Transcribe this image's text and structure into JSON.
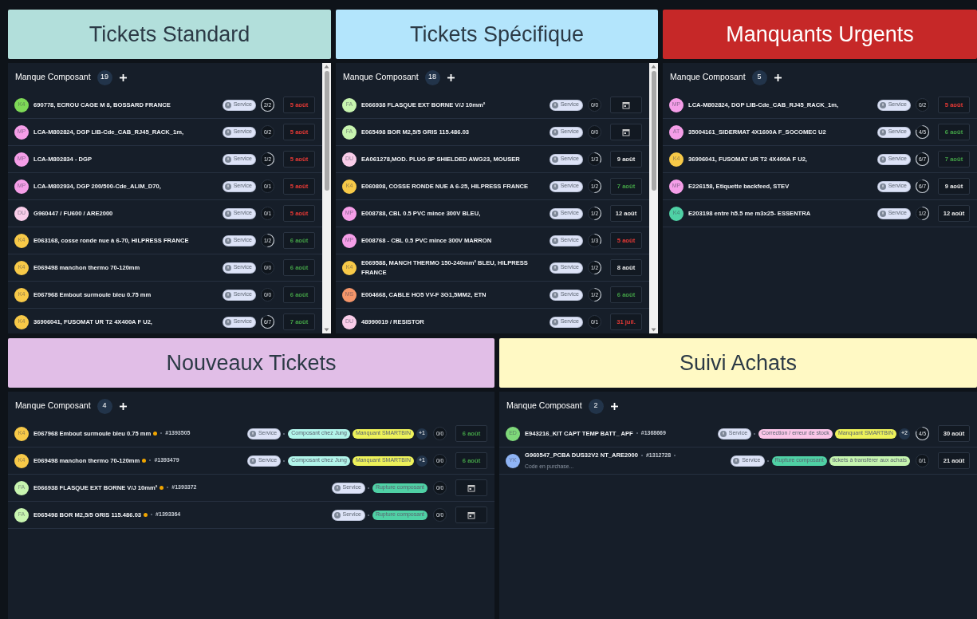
{
  "board_rows": [
    {
      "boards": [
        {
          "title": "Tickets Standard",
          "color": "#b2dfdb",
          "list_title": "Manque Composant",
          "count": "19",
          "scrollable": true,
          "items": [
            {
              "initials": "K4",
              "color": "#7ed957",
              "title": "690778, ECROU CAGE M 8, BOSSARD FRANCE",
              "tags": [
                {
                  "kind": "service",
                  "label": "Service",
                  "color": "#dde3f7"
                }
              ],
              "progress": "2/2",
              "due": {
                "kind": "date",
                "text": "5 août",
                "color": "#e53935"
              }
            },
            {
              "initials": "MP",
              "color": "#f59ee8",
              "title": "LCA-M802824, DGP LIB-Cde_CAB_RJ45_RACK_1m,",
              "tags": [
                {
                  "kind": "service",
                  "label": "Service",
                  "color": "#dde3f7"
                }
              ],
              "progress": "0/2",
              "due": {
                "kind": "date",
                "text": "5 août",
                "color": "#e53935"
              }
            },
            {
              "initials": "MP",
              "color": "#f59ee8",
              "title": "LCA-M802834 - DGP",
              "tags": [
                {
                  "kind": "service",
                  "label": "Service",
                  "color": "#dde3f7"
                }
              ],
              "progress": "1/2",
              "due": {
                "kind": "date",
                "text": "5 août",
                "color": "#e53935"
              }
            },
            {
              "initials": "MP",
              "color": "#f59ee8",
              "title": "LCA-M802934, DGP 200/500-Cde_ALIM_D70,",
              "tags": [
                {
                  "kind": "service",
                  "label": "Service",
                  "color": "#dde3f7"
                }
              ],
              "progress": "0/1",
              "due": {
                "kind": "date",
                "text": "5 août",
                "color": "#e53935"
              }
            },
            {
              "initials": "DU",
              "color": "#f9cde9",
              "title": "G960447 / FU600 / ARE2000",
              "tags": [
                {
                  "kind": "service",
                  "label": "Service",
                  "color": "#dde3f7"
                }
              ],
              "progress": "0/1",
              "due": {
                "kind": "date",
                "text": "5 août",
                "color": "#e53935"
              }
            },
            {
              "initials": "K4",
              "color": "#f7c948",
              "title": "E063168, cosse ronde nue à 6-70, HILPRESS FRANCE",
              "tags": [
                {
                  "kind": "service",
                  "label": "Service",
                  "color": "#dde3f7"
                }
              ],
              "progress": "1/2",
              "due": {
                "kind": "date",
                "text": "6 août",
                "color": "#43a047"
              }
            },
            {
              "initials": "K4",
              "color": "#f7c948",
              "title": "E069498 manchon thermo 70-120mm",
              "tags": [
                {
                  "kind": "service",
                  "label": "Service",
                  "color": "#dde3f7"
                }
              ],
              "progress": "0/0",
              "due": {
                "kind": "date",
                "text": "6 août",
                "color": "#43a047"
              }
            },
            {
              "initials": "K4",
              "color": "#f7c948",
              "title": "E067968 Embout surmoule bleu 0.75 mm",
              "tags": [
                {
                  "kind": "service",
                  "label": "Service",
                  "color": "#dde3f7"
                }
              ],
              "progress": "0/0",
              "due": {
                "kind": "date",
                "text": "6 août",
                "color": "#43a047"
              }
            },
            {
              "initials": "K4",
              "color": "#f7c948",
              "title": "36906041, FUSOMAT UR T2 4X400A F U2,",
              "tags": [
                {
                  "kind": "service",
                  "label": "Service",
                  "color": "#dde3f7"
                }
              ],
              "progress": "6/7",
              "due": {
                "kind": "date",
                "text": "7 août",
                "color": "#43a047"
              }
            }
          ]
        },
        {
          "title": "Tickets Spécifique",
          "color": "#b3e5fc",
          "list_title": "Manque Composant",
          "count": "18",
          "scrollable": true,
          "items": [
            {
              "initials": "FA",
              "color": "#c8f5b0",
              "title": "E066938 FLASQUE EXT BORNE V/J 10mm²",
              "tags": [
                {
                  "kind": "service",
                  "label": "Service",
                  "color": "#dde3f7"
                }
              ],
              "progress": "0/0",
              "due": {
                "kind": "calendar"
              }
            },
            {
              "initials": "FA",
              "color": "#c8f5b0",
              "title": "E065498 BOR M2,5/5 GRIS 115.486.03",
              "tags": [
                {
                  "kind": "service",
                  "label": "Service",
                  "color": "#dde3f7"
                }
              ],
              "progress": "0/0",
              "due": {
                "kind": "calendar"
              }
            },
            {
              "initials": "DU",
              "color": "#f9cde9",
              "title": "EA061278,MOD. PLUG 8P SHIELDED AWG23, MOUSER",
              "tags": [
                {
                  "kind": "service",
                  "label": "Service",
                  "color": "#dde3f7"
                }
              ],
              "progress": "1/3",
              "due": {
                "kind": "date",
                "text": "9 août",
                "color": "#e8e8e8"
              }
            },
            {
              "initials": "K4",
              "color": "#f7c948",
              "title": "E060808, COSSE RONDE NUE A 6-25, HILPRESS FRANCE",
              "tags": [
                {
                  "kind": "service",
                  "label": "Service",
                  "color": "#dde3f7"
                }
              ],
              "progress": "1/2",
              "due": {
                "kind": "date",
                "text": "7 août",
                "color": "#43a047"
              }
            },
            {
              "initials": "MP",
              "color": "#f59ee8",
              "title": "E008788, CBL 0.5 PVC mince 300V BLEU,",
              "tags": [
                {
                  "kind": "service",
                  "label": "Service",
                  "color": "#dde3f7"
                }
              ],
              "progress": "1/2",
              "due": {
                "kind": "date",
                "text": "12 août",
                "color": "#e8e8e8"
              }
            },
            {
              "initials": "MP",
              "color": "#f59ee8",
              "title": "E008768 - CBL 0.5 PVC mince 300V MARRON",
              "tags": [
                {
                  "kind": "service",
                  "label": "Service",
                  "color": "#dde3f7"
                }
              ],
              "progress": "1/3",
              "due": {
                "kind": "date",
                "text": "5 août",
                "color": "#e53935"
              }
            },
            {
              "initials": "K4",
              "color": "#f7c948",
              "title": "E069588, MANCH THERMO 150-240mm² BLEU, HILPRESS FRANCE",
              "tags": [
                {
                  "kind": "service",
                  "label": "Service",
                  "color": "#dde3f7"
                }
              ],
              "progress": "1/2",
              "due": {
                "kind": "date",
                "text": "8 août",
                "color": "#e8e8e8"
              }
            },
            {
              "initials": "MS",
              "color": "#f5966a",
              "title": "E004668, CABLE HO5 VV-F 3G1,5MM2, ETN",
              "tags": [
                {
                  "kind": "service",
                  "label": "Service",
                  "color": "#dde3f7"
                }
              ],
              "progress": "1/2",
              "due": {
                "kind": "date",
                "text": "6 août",
                "color": "#43a047"
              }
            },
            {
              "initials": "DU",
              "color": "#f9cde9",
              "title": "48990019 / RESISTOR",
              "tags": [
                {
                  "kind": "service",
                  "label": "Service",
                  "color": "#dde3f7"
                }
              ],
              "progress": "0/1",
              "due": {
                "kind": "date",
                "text": "31 juil.",
                "color": "#e53935"
              }
            }
          ]
        },
        {
          "title": "Manquants Urgents",
          "color": "#c62828",
          "list_title": "Manque Composant",
          "count": "5",
          "scrollable": false,
          "items": [
            {
              "initials": "MP",
              "color": "#f59ee8",
              "title": "LCA-M802824, DGP LIB-Cde_CAB_RJ45_RACK_1m,",
              "tags": [
                {
                  "kind": "service",
                  "label": "Service",
                  "color": "#dde3f7"
                }
              ],
              "progress": "0/2",
              "due": {
                "kind": "date",
                "text": "5 août",
                "color": "#e53935"
              }
            },
            {
              "initials": "AT",
              "color": "#f59ee8",
              "title": "35004161_SIDERMAT 4X1600A F_SOCOMEC U2",
              "tags": [
                {
                  "kind": "service",
                  "label": "Service",
                  "color": "#dde3f7"
                }
              ],
              "progress": "4/5",
              "due": {
                "kind": "date",
                "text": "6 août",
                "color": "#43a047"
              }
            },
            {
              "initials": "K4",
              "color": "#f7c948",
              "title": "36906041, FUSOMAT UR T2 4X400A F U2,",
              "tags": [
                {
                  "kind": "service",
                  "label": "Service",
                  "color": "#dde3f7"
                }
              ],
              "progress": "6/7",
              "due": {
                "kind": "date",
                "text": "7 août",
                "color": "#43a047"
              }
            },
            {
              "initials": "MP",
              "color": "#f59ee8",
              "title": "E226158, Etiquette backfeed, STEV",
              "tags": [
                {
                  "kind": "service",
                  "label": "Service",
                  "color": "#dde3f7"
                }
              ],
              "progress": "6/7",
              "due": {
                "kind": "date",
                "text": "9 août",
                "color": "#e8e8e8"
              }
            },
            {
              "initials": "K4",
              "color": "#4fd1a5",
              "title": "E203198 entre h5.5 me m3x25- ESSENTRA",
              "tags": [
                {
                  "kind": "service",
                  "label": "Service",
                  "color": "#dde3f7"
                }
              ],
              "progress": "1/2",
              "due": {
                "kind": "date",
                "text": "12 août",
                "color": "#e8e8e8"
              }
            }
          ]
        }
      ]
    },
    {
      "boards": [
        {
          "title": "Nouveaux Tickets",
          "color": "#e1bee7",
          "list_title": "Manque Composant",
          "count": "4",
          "scrollable": false,
          "items": [
            {
              "initials": "K4",
              "color": "#f7c948",
              "title": "E067968 Embout surmoule bleu 0.75 mm",
              "flagged": true,
              "ref": "#1393505",
              "tags": [
                {
                  "kind": "service",
                  "label": "Service",
                  "color": "#dde3f7"
                },
                {
                  "kind": "label",
                  "label": "Composant chez Jung",
                  "color": "#b2f5ea"
                },
                {
                  "kind": "label",
                  "label": "Manquant SMARTBIN",
                  "color": "#eef25a"
                }
              ],
              "more": "+1",
              "progress": "0/0",
              "due": {
                "kind": "date",
                "text": "6 août",
                "color": "#43a047"
              }
            },
            {
              "initials": "K4",
              "color": "#f7c948",
              "title": "E069498 manchon thermo 70-120mm",
              "flagged": true,
              "ref": "#1393479",
              "tags": [
                {
                  "kind": "service",
                  "label": "Service",
                  "color": "#dde3f7"
                },
                {
                  "kind": "label",
                  "label": "Composant chez Jung",
                  "color": "#b2f5ea"
                },
                {
                  "kind": "label",
                  "label": "Manquant SMARTBIN",
                  "color": "#eef25a"
                }
              ],
              "more": "+1",
              "progress": "0/0",
              "due": {
                "kind": "date",
                "text": "6 août",
                "color": "#43a047"
              }
            },
            {
              "initials": "FA",
              "color": "#c8f5b0",
              "title": "E066938 FLASQUE EXT BORNE V/J 10mm²",
              "flagged": true,
              "ref": "#1393372",
              "tags": [
                {
                  "kind": "service",
                  "label": "Service",
                  "color": "#dde3f7"
                },
                {
                  "kind": "label",
                  "label": "Rupture composant",
                  "color": "#4fd1a5"
                }
              ],
              "progress": "0/0",
              "due": {
                "kind": "calendar"
              }
            },
            {
              "initials": "FA",
              "color": "#c8f5b0",
              "title": "E065498 BOR M2,5/5 GRIS 115.486.03",
              "flagged": true,
              "ref": "#1393364",
              "tags": [
                {
                  "kind": "service",
                  "label": "Service",
                  "color": "#dde3f7"
                },
                {
                  "kind": "label",
                  "label": "Rupture composant",
                  "color": "#4fd1a5"
                }
              ],
              "progress": "0/0",
              "due": {
                "kind": "calendar"
              }
            }
          ]
        },
        {
          "title": "Suivi Achats",
          "color": "#fff9c4",
          "list_title": "Manque Composant",
          "count": "2",
          "scrollable": false,
          "items": [
            {
              "initials": "ED",
              "color": "#7fd87a",
              "title": "E943216_KIT CAPT TEMP BATT_ APF",
              "ref": "#1368669",
              "tags": [
                {
                  "kind": "service",
                  "label": "Service",
                  "color": "#dde3f7"
                },
                {
                  "kind": "label",
                  "label": "Correction / erreur de stock",
                  "color": "#fbc6e8"
                },
                {
                  "kind": "label",
                  "label": "Manquant SMARTBIN",
                  "color": "#eef25a"
                }
              ],
              "more": "+2",
              "progress": "4/5",
              "due": {
                "kind": "date",
                "text": "30 août",
                "color": "#e8e8e8"
              }
            },
            {
              "initials": "YK",
              "color": "#8fb4f5",
              "title": "G960547_PCBA DUS32V2 NT_ARE2000",
              "ref": "#1312728",
              "note": "Code en purchase...",
              "tags": [
                {
                  "kind": "service",
                  "label": "Service",
                  "color": "#dde3f7"
                },
                {
                  "kind": "label",
                  "label": "Rupture composant",
                  "color": "#4fd1a5"
                },
                {
                  "kind": "label",
                  "label": "tickets à transférer aux achats",
                  "color": "#c6f5b0"
                }
              ],
              "progress": "0/1",
              "due": {
                "kind": "date",
                "text": "21 août",
                "color": "#e8e8e8"
              }
            }
          ]
        }
      ]
    }
  ]
}
